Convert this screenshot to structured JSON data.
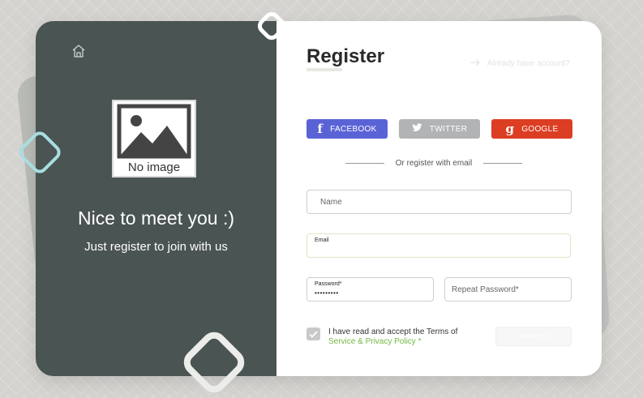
{
  "left": {
    "image_placeholder": "No image",
    "welcome_title": "Nice to meet you :)",
    "welcome_subtitle": "Just register to join with us"
  },
  "form": {
    "title": "Register",
    "login_link": "Already have account?",
    "social": {
      "facebook": "FACEBOOK",
      "twitter": "TWITTER",
      "google": "GOOGLE"
    },
    "divider_text": "Or register with email",
    "name_placeholder": "Name",
    "email_label": "Email",
    "password_label": "Password*",
    "password_value": "•••••••••",
    "repeat_placeholder": "Repeat Password*",
    "terms_text": "I have read and accept the Terms of",
    "terms_link": "Service & Privacy Policy *",
    "terms_checked": true,
    "register_label": "REGISTER"
  },
  "colors": {
    "left_panel": "#4a5453",
    "facebook": "#5a63d6",
    "twitter": "#b2b3b4",
    "google": "#dc3e23",
    "link_green": "#72b845"
  }
}
